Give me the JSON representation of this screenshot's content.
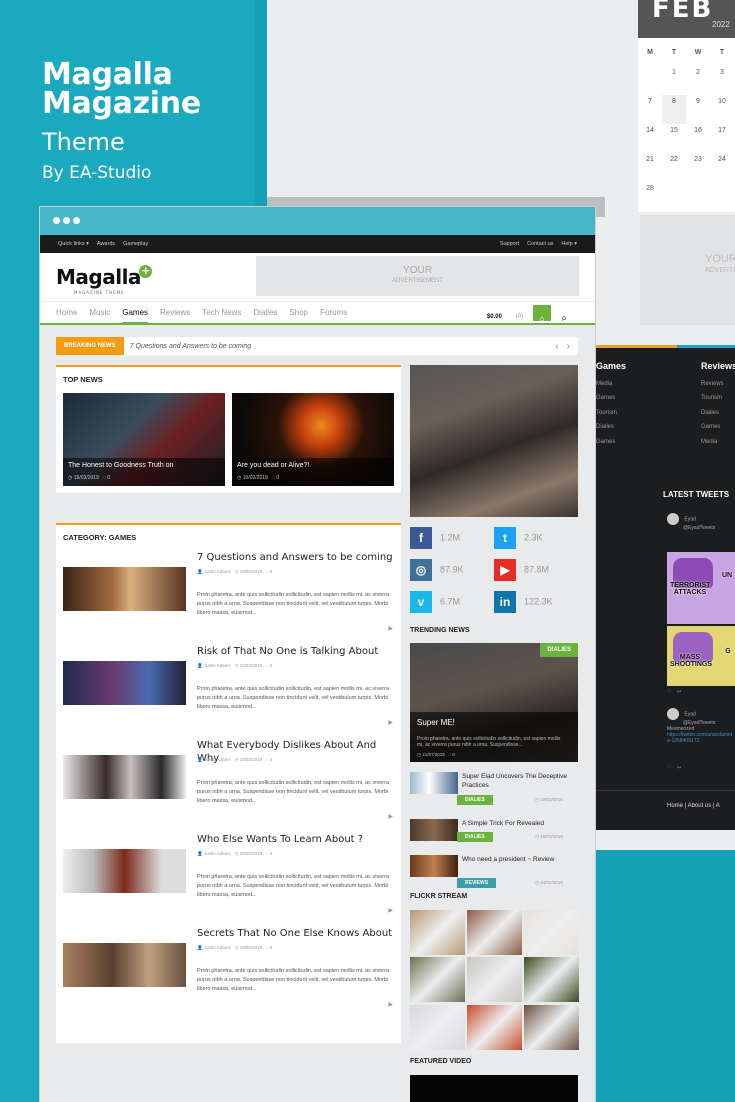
{
  "promo": {
    "title1": "Magalla",
    "title2": "Magazine",
    "subtitle": "Theme",
    "by": "By EA-Studio"
  },
  "calendar": {
    "month": "FEB",
    "year": "2022",
    "dow": [
      "M",
      "T",
      "W",
      "T"
    ],
    "days": [
      "",
      "1",
      "2",
      "3",
      "7",
      "8",
      "9",
      "10",
      "14",
      "15",
      "16",
      "17",
      "21",
      "22",
      "23",
      "24",
      "28",
      "",
      "",
      ""
    ],
    "selected": "8"
  },
  "side_ad": {
    "line1": "YOUR",
    "line2": "ADVERTISEM"
  },
  "footer": {
    "col1": {
      "title": "Games",
      "items": [
        "Media",
        "Games",
        "Tourism",
        "Dialies",
        "Games"
      ]
    },
    "col2": {
      "title": "Reviews",
      "items": [
        "Reviews",
        "Tourism",
        "Dialies",
        "Games",
        "Media"
      ]
    },
    "tweets_title": "LATEST TWEETS",
    "tweet1": {
      "name": "Eyad",
      "handle": "@EyadTweets"
    },
    "meme1": {
      "top": "TERRORIST ATTACKS",
      "side": "UN"
    },
    "meme2": {
      "top": "MASS SHOOTINGS",
      "side": "G"
    },
    "tweet2": {
      "name": "Eyad",
      "handle": "@EyadTweets",
      "text": "Mesmerized",
      "link": "https://twitter.com/anandamide-1268409173"
    },
    "links": "Home | About us | A"
  },
  "site": {
    "topbar": {
      "left": [
        "Quick links ▾",
        "Awards",
        "Gameplay"
      ],
      "right": [
        "Support",
        "Contact us",
        "Help ▾"
      ]
    },
    "logo": "Magalla",
    "logo_sub": "MAGAZINE THEME",
    "logo_plus": "+",
    "ad": {
      "line1": "YOUR",
      "line2": "ADVERTISEMENT"
    },
    "nav": [
      "Home",
      "Music",
      "Games",
      "Reviews",
      "Tech News",
      "Dialies",
      "Shop",
      "Forums"
    ],
    "nav_active": 2,
    "cart": "$0.00",
    "cart_count": "(0)",
    "breaking": {
      "label": "BREAKING NEWS",
      "text": "7 Questions and Answers to be coming"
    },
    "top_news": {
      "title": "TOP NEWS",
      "items": [
        {
          "title": "The Honest to Goodness Truth on",
          "date": "19/03/2019",
          "comments": "0"
        },
        {
          "title": "Are you dead or Alive?!",
          "date": "10/02/2019",
          "comments": "0"
        }
      ]
    },
    "category": {
      "title": "CATEGORY: GAMES",
      "posts": [
        {
          "title": "7 Questions and Answers to be coming",
          "author": "Justin Adams",
          "date": "19/03/2019",
          "comments": "0",
          "excerpt": "Proin pharetra, ante quis sollicitudin sollicitudin, est sapien mollis mi, ac viverra purus nibh a urna. Suspendisse non tincidunt velit, vel vestibulum turpis. Morbi libero massa, euismod..."
        },
        {
          "title": "Risk of That No One is Talking About",
          "author": "Justin Adams",
          "date": "19/03/2019",
          "comments": "0",
          "excerpt": "Proin pharetra, ante quis sollicitudin sollicitudin, est sapien mollis mi, ac viverra purus nibh a urna. Suspendisse non tincidunt velit, vel vestibulum turpis. Morbi libero massa, euismod..."
        },
        {
          "title": "What Everybody Dislikes About And Why",
          "author": "Justin Adams",
          "date": "19/03/2019",
          "comments": "0",
          "excerpt": "Proin pharetra, ante quis sollicitudin sollicitudin, est sapien mollis mi, ac viverra purus nibh a urna. Suspendisse non tincidunt velit, vel vestibulum turpis. Morbi libero massa, euismod..."
        },
        {
          "title": "Who Else Wants To Learn About ?",
          "author": "Justin Adams",
          "date": "29/03/2019",
          "comments": "0",
          "excerpt": "Proin pharetra, ante quis sollicitudin sollicitudin, est sapien mollis mi, ac viverra purus nibh a urna. Suspendisse non tincidunt velit, vel vestibulum turpis. Morbi libero massa, euismod..."
        },
        {
          "title": "Secrets That No One Else Knows About",
          "author": "Justin Adams",
          "date": "19/03/2019",
          "comments": "0",
          "excerpt": "Proin pharetra, ante quis sollicitudin sollicitudin, est sapien mollis mi, ac viverra purus nibh a urna. Suspendisse non tincidunt velit, vel vestibulum turpis. Morbi libero massa, euismod..."
        }
      ]
    },
    "social": [
      {
        "icon": "f",
        "count": "1.2M",
        "color": "#3b5998"
      },
      {
        "icon": "t",
        "count": "2.3K",
        "color": "#1da1f2"
      },
      {
        "icon": "◎",
        "count": "87.9K",
        "color": "#3f729b"
      },
      {
        "icon": "▶",
        "count": "87.8M",
        "color": "#e52d27"
      },
      {
        "icon": "v",
        "count": "6.7M",
        "color": "#1ab7ea"
      },
      {
        "icon": "in",
        "count": "122.3K",
        "color": "#0e76a8"
      }
    ],
    "trending": {
      "title": "TRENDING NEWS",
      "tag": "DIALIES",
      "headline": "Super ME!",
      "excerpt": "Proin pharetra, ante quis sollicitudin sollicitudin, est sapien mollis mi, ac viverra purus nibh a urna. Suspendisse...",
      "date": "21/07/2019",
      "comments": "0",
      "list": [
        {
          "title": "Super Eiad Uncovers The Deceptive Practices",
          "tag": "DIALIES",
          "tag_color": "#6cb33e",
          "date": "19/03/2019"
        },
        {
          "title": "A Simple Trick For Revealed",
          "tag": "DIALIES",
          "tag_color": "#6cb33e",
          "date": "19/03/2019"
        },
        {
          "title": "Who need a president ~ Review",
          "tag": "REVIEWS",
          "tag_color": "#3a9fa8",
          "date": "24/02/2019"
        }
      ]
    },
    "flickr_title": "FLICKR STREAM",
    "video_title": "FEATURED VIDEO"
  },
  "colors": {
    "teal": "#15a2b7",
    "accent": "#6cb33e",
    "orange": "#f39c12"
  }
}
